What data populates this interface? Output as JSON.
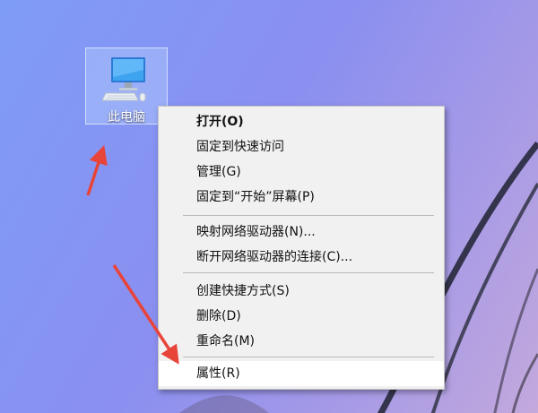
{
  "desktop": {
    "icon": {
      "name": "pc-icon",
      "label": "此电脑"
    }
  },
  "context_menu": {
    "items": [
      {
        "label": "打开(O)",
        "bold": true
      },
      {
        "label": "固定到快速访问"
      },
      {
        "label": "管理(G)"
      },
      {
        "label": "固定到“开始”屏幕(P)"
      },
      {
        "label": "映射网络驱动器(N)..."
      },
      {
        "label": "断开网络驱动器的连接(C)..."
      },
      {
        "label": "创建快捷方式(S)"
      },
      {
        "label": "删除(D)"
      },
      {
        "label": "重命名(M)"
      },
      {
        "label": "属性(R)",
        "highlighted": true
      }
    ]
  },
  "colors": {
    "arrow": "#e8443a",
    "menu_background": "#f1f1f1",
    "highlight_background": "#ffffff"
  }
}
